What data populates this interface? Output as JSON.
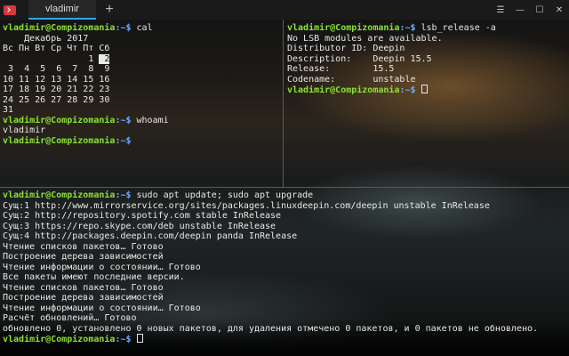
{
  "window": {
    "tab_title": "vladimir",
    "add_tab": "+",
    "controls": {
      "settings": "☰",
      "minimize": "—",
      "maximize": "☐",
      "close": "✕"
    }
  },
  "prompt": {
    "user_host": "vladimir@Compizomania",
    "path": ":~$"
  },
  "pane_top_left": {
    "cmd1": " cal",
    "cal_header": "    Декабрь 2017",
    "cal_days": "Вс Пн Вт Ср Чт Пт Сб",
    "cal_row1": "                1 ",
    "cal_today": " 2",
    "cal_row2": " 3  4  5  6  7  8  9",
    "cal_row3": "10 11 12 13 14 15 16",
    "cal_row4": "17 18 19 20 21 22 23",
    "cal_row5": "24 25 26 27 28 29 30",
    "cal_row6": "31",
    "cmd2": " whoami",
    "whoami_out": "vladimir",
    "cmd3": " "
  },
  "pane_top_right": {
    "cmd1": " lsb_release -a",
    "out1": "No LSB modules are available.",
    "out2": "Distributor ID: Deepin",
    "out3": "Description:    Deepin 15.5",
    "out4": "Release:        15.5",
    "out5": "Codename:       unstable",
    "cmd2": " "
  },
  "pane_bottom": {
    "cmd1": " sudo apt update; sudo apt upgrade",
    "lines": [
      "Сущ:1 http://www.mirrorservice.org/sites/packages.linuxdeepin.com/deepin unstable InRelease",
      "Сущ:2 http://repository.spotify.com stable InRelease",
      "Сущ:3 https://repo.skype.com/deb unstable InRelease",
      "Сущ:4 http://packages.deepin.com/deepin panda InRelease",
      "Чтение списков пакетов… Готово",
      "Построение дерева зависимостей",
      "Чтение информации о состоянии… Готово",
      "Все пакеты имеют последние версии.",
      "Чтение списков пакетов… Готово",
      "Построение дерева зависимостей",
      "Чтение информации о состоянии… Готово",
      "Расчёт обновлений… Готово",
      "обновлено 0, установлено 0 новых пакетов, для удаления отмечено 0 пакетов, и 0 пакетов не обновлено."
    ],
    "cmd2": " "
  }
}
